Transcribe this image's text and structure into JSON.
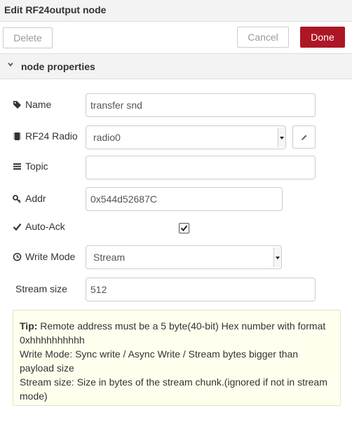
{
  "dialog": {
    "title": "Edit RF24output node"
  },
  "toolbar": {
    "delete_label": "Delete",
    "cancel_label": "Cancel",
    "done_label": "Done",
    "done_color": "#ad1625"
  },
  "section": {
    "label": "node properties",
    "icon": "chevron-down-icon"
  },
  "fields": {
    "name": {
      "label": "Name",
      "icon": "tag-icon",
      "value": "transfer snd"
    },
    "radio": {
      "label": "RF24 Radio",
      "icon": "chip-icon",
      "value": "radio0",
      "edit_icon": "pencil-icon"
    },
    "topic": {
      "label": "Topic",
      "icon": "list-icon",
      "value": ""
    },
    "addr": {
      "label": "Addr",
      "icon": "key-icon",
      "value": "0x544d52687C"
    },
    "autoack": {
      "label": "Auto-Ack",
      "icon": "check-icon",
      "checked": true
    },
    "writemode": {
      "label": "Write Mode",
      "icon": "clock-icon",
      "value": "Stream"
    },
    "streamsize": {
      "label": "Stream size",
      "value": "512"
    }
  },
  "tip": {
    "heading": "Tip:",
    "line1": "Remote address must be a 5 byte(40-bit) Hex number with format 0xhhhhhhhhhh",
    "line2": "Write Mode: Sync write / Async Write / Stream bytes bigger than payload size",
    "line3": "Stream size: Size in bytes of the stream chunk.(ignored if not in stream mode)"
  }
}
